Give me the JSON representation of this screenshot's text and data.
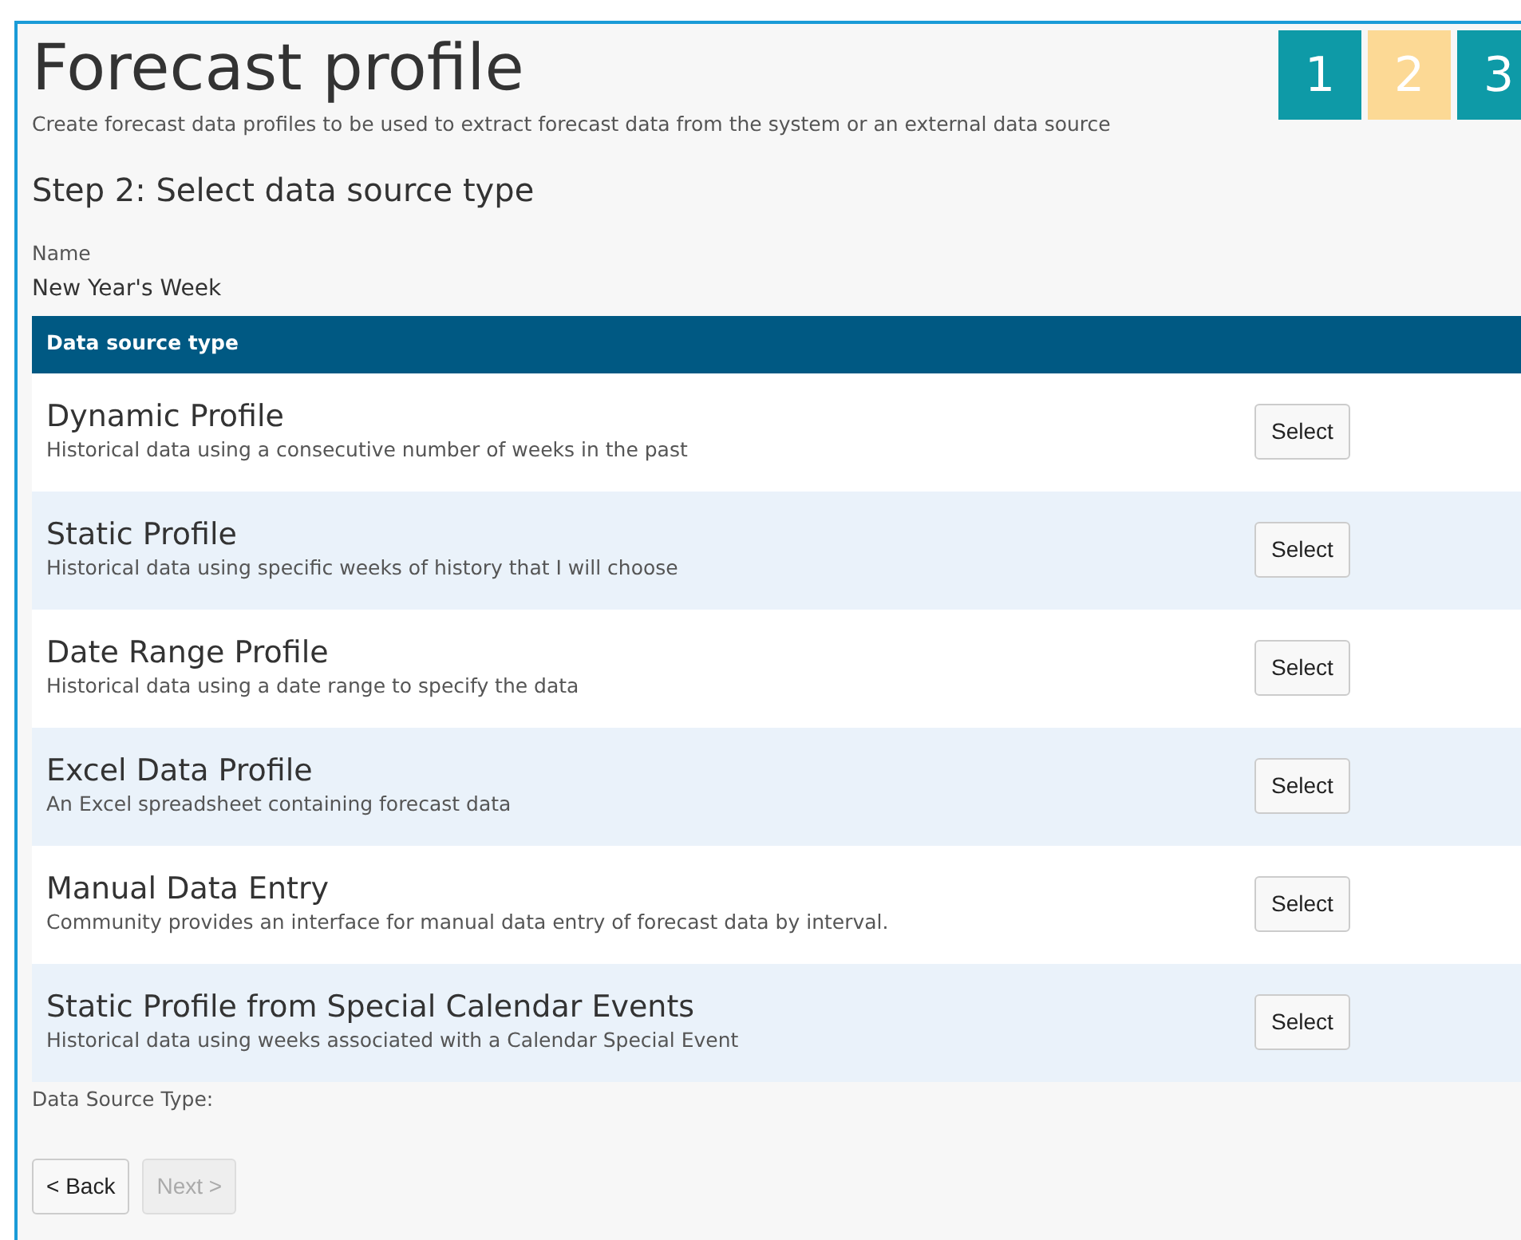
{
  "header": {
    "title": "Forecast profile",
    "subtitle": "Create forecast data profiles to be used to extract forecast data from the system or an external data source"
  },
  "steps": [
    {
      "label": "1",
      "selected": false
    },
    {
      "label": "2",
      "selected": true
    },
    {
      "label": "3",
      "selected": false
    }
  ],
  "step_heading": "Step 2: Select data source type",
  "name_field": {
    "label": "Name",
    "value": "New Year's Week"
  },
  "table": {
    "header": "Data source type",
    "rows": [
      {
        "title": "Dynamic Profile",
        "description": "Historical data using a consecutive number of weeks in the past",
        "button": "Select"
      },
      {
        "title": "Static Profile",
        "description": "Historical data using specific weeks of history that I will choose",
        "button": "Select"
      },
      {
        "title": "Date Range Profile",
        "description": "Historical data using a date range to specify the data",
        "button": "Select"
      },
      {
        "title": "Excel Data Profile",
        "description": "An Excel spreadsheet containing forecast data",
        "button": "Select"
      },
      {
        "title": "Manual Data Entry",
        "description": "Community provides an interface for manual data entry of forecast data by interval.",
        "button": "Select"
      },
      {
        "title": "Static Profile from Special Calendar Events",
        "description": "Historical data using weeks associated with a Calendar Special Event",
        "button": "Select"
      }
    ]
  },
  "selected_type_label": "Data Source Type:",
  "buttons": [
    {
      "label": "< Back",
      "disabled": false
    },
    {
      "label": "Next >",
      "disabled": true
    }
  ]
}
